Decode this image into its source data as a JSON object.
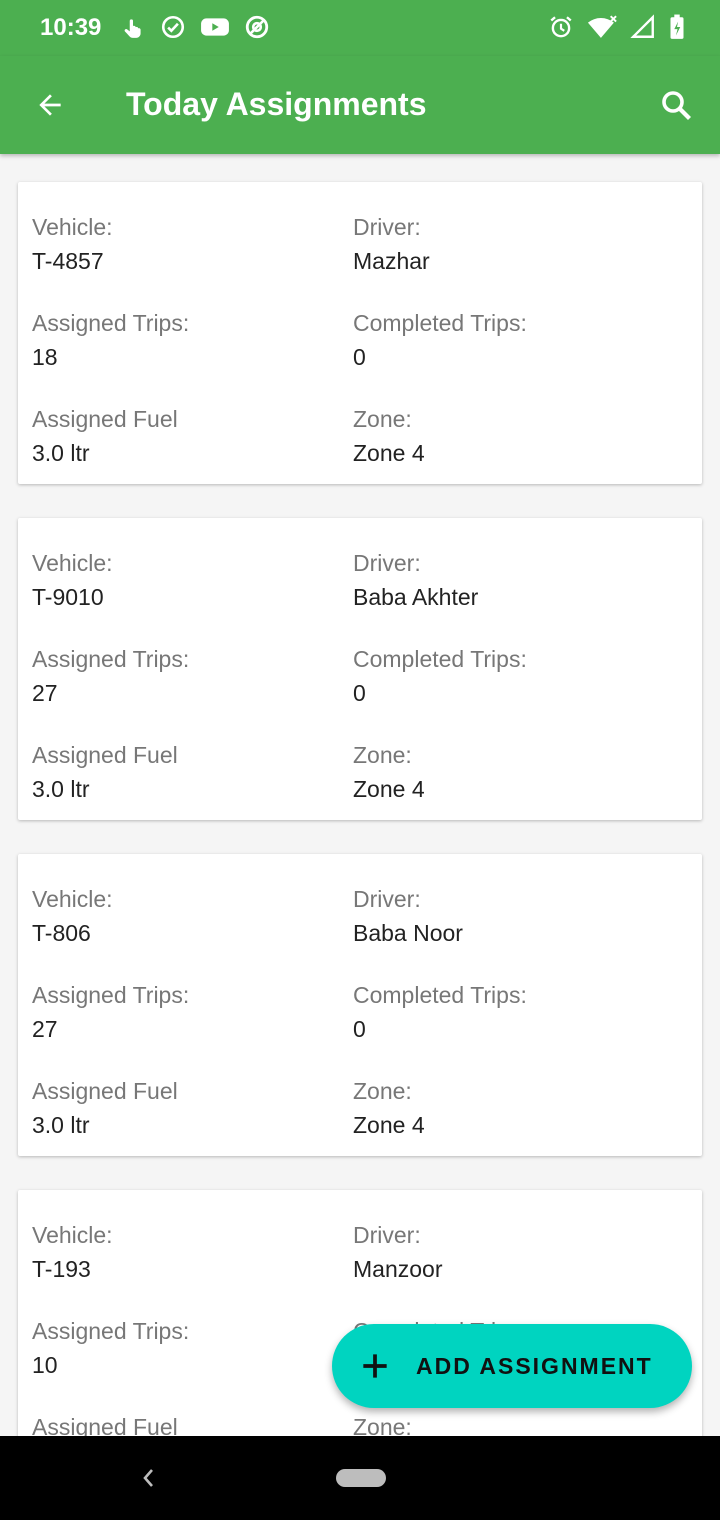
{
  "status_bar": {
    "time": "10:39",
    "left_icons": [
      "touch-icon",
      "check-circle-icon",
      "youtube-icon",
      "at-icon"
    ],
    "right_icons": [
      "alarm-icon",
      "wifi-icon",
      "signal-icon",
      "battery-icon"
    ]
  },
  "app_bar": {
    "title": "Today Assignments",
    "back_icon": "arrow-back-icon",
    "search_icon": "search-icon",
    "color": "#4caf50"
  },
  "labels": {
    "vehicle": "Vehicle:",
    "driver": "Driver:",
    "assigned_trips": "Assigned Trips:",
    "completed_trips": "Completed Trips:",
    "assigned_fuel": "Assigned Fuel",
    "zone": "Zone:"
  },
  "assignments": [
    {
      "vehicle": "T-4857",
      "driver": "Mazhar",
      "assigned_trips": "18",
      "completed_trips": "0",
      "fuel": "3.0 ltr",
      "zone": "Zone 4"
    },
    {
      "vehicle": "T-9010",
      "driver": "Baba Akhter",
      "assigned_trips": "27",
      "completed_trips": "0",
      "fuel": "3.0 ltr",
      "zone": "Zone 4"
    },
    {
      "vehicle": "T-806",
      "driver": "Baba Noor",
      "assigned_trips": "27",
      "completed_trips": "0",
      "fuel": "3.0 ltr",
      "zone": "Zone 4"
    },
    {
      "vehicle": "T-193",
      "driver": "Manzoor",
      "assigned_trips": "10"
    }
  ],
  "fab": {
    "label": "ADD ASSIGNMENT",
    "icon": "plus-icon",
    "color": "#00d4c0"
  },
  "nav_bar": {
    "back_icon": "nav-back-icon",
    "home_icon": "home-pill-icon"
  }
}
